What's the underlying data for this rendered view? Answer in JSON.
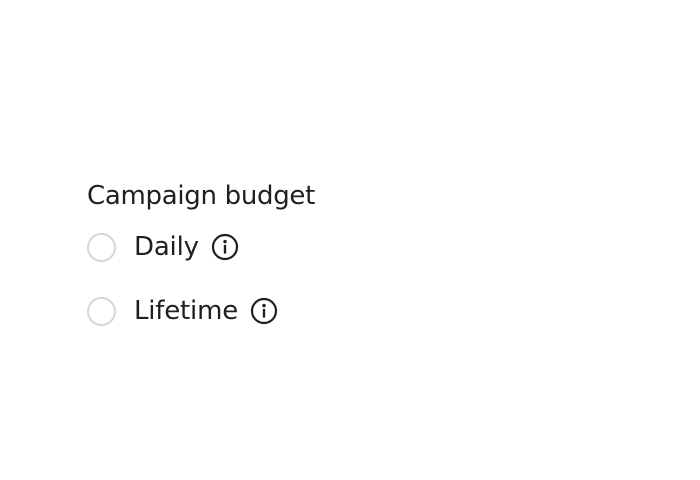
{
  "budget": {
    "label": "Campaign budget",
    "options": [
      {
        "label": "Daily",
        "selected": false,
        "icon": "info-icon"
      },
      {
        "label": "Lifetime",
        "selected": false,
        "icon": "info-icon"
      }
    ]
  },
  "colors": {
    "text": "#1f1f23",
    "radio_border": "#d6d6da",
    "background": "#ffffff"
  }
}
